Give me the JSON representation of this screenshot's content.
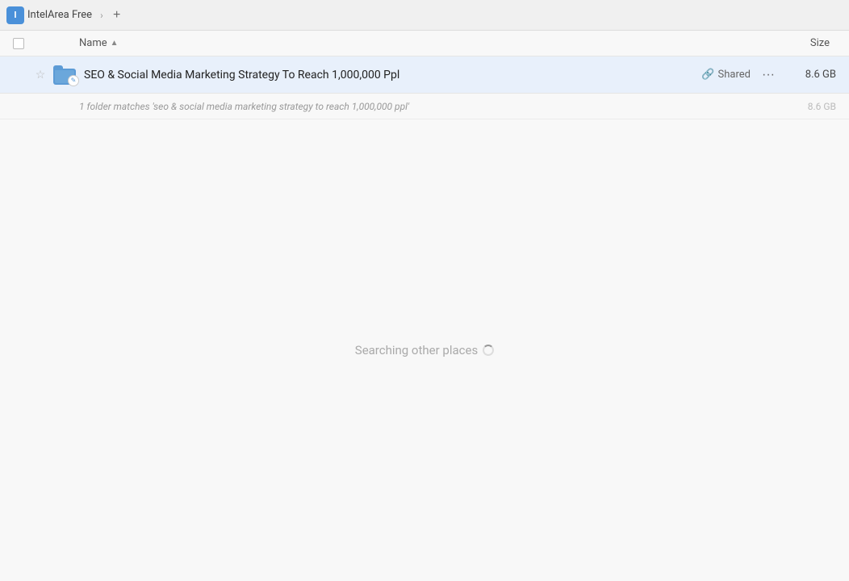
{
  "topbar": {
    "app_icon_label": "I",
    "app_title": "IntelArea Free",
    "add_tab_label": "+"
  },
  "columns": {
    "name_label": "Name",
    "sort_arrow": "▲",
    "size_label": "Size"
  },
  "file_row": {
    "file_name": "SEO & Social Media Marketing Strategy To Reach 1,000,000 Ppl",
    "shared_label": "Shared",
    "more_label": "···",
    "file_size": "8.6 GB",
    "star": "☆",
    "link_icon": "🔗"
  },
  "match_row": {
    "match_text": "1 folder matches 'seo & social media marketing strategy to reach 1,000,000 ppl'",
    "match_size": "8.6 GB"
  },
  "main": {
    "searching_text": "Searching other places"
  },
  "colors": {
    "row_bg": "#e8f0fb",
    "header_bg": "#f8f8f8",
    "topbar_bg": "#f0f0f0",
    "folder_color": "#5c9bd6"
  }
}
